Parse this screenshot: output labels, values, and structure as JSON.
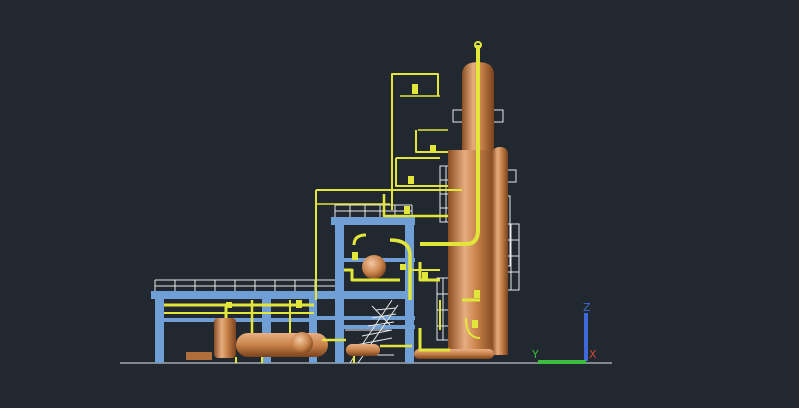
{
  "viewport": {
    "background": "#212830",
    "visual_style": "Realistic"
  },
  "model": {
    "description_visible": false,
    "colors": {
      "steel_structure": "#6f9fd4",
      "vessels": "#c8824a",
      "vessel_highlight": "#e8b083",
      "piping": "#e3e63a",
      "platform_rails": "#e6e6e6",
      "ground_line": "#e6e6e6"
    }
  },
  "ucs_icon": {
    "x_label": "X",
    "y_label": "Y",
    "z_label": "Z",
    "x_color": "#d8463a",
    "y_color": "#3dbb3d",
    "z_color": "#3d6ad8"
  }
}
